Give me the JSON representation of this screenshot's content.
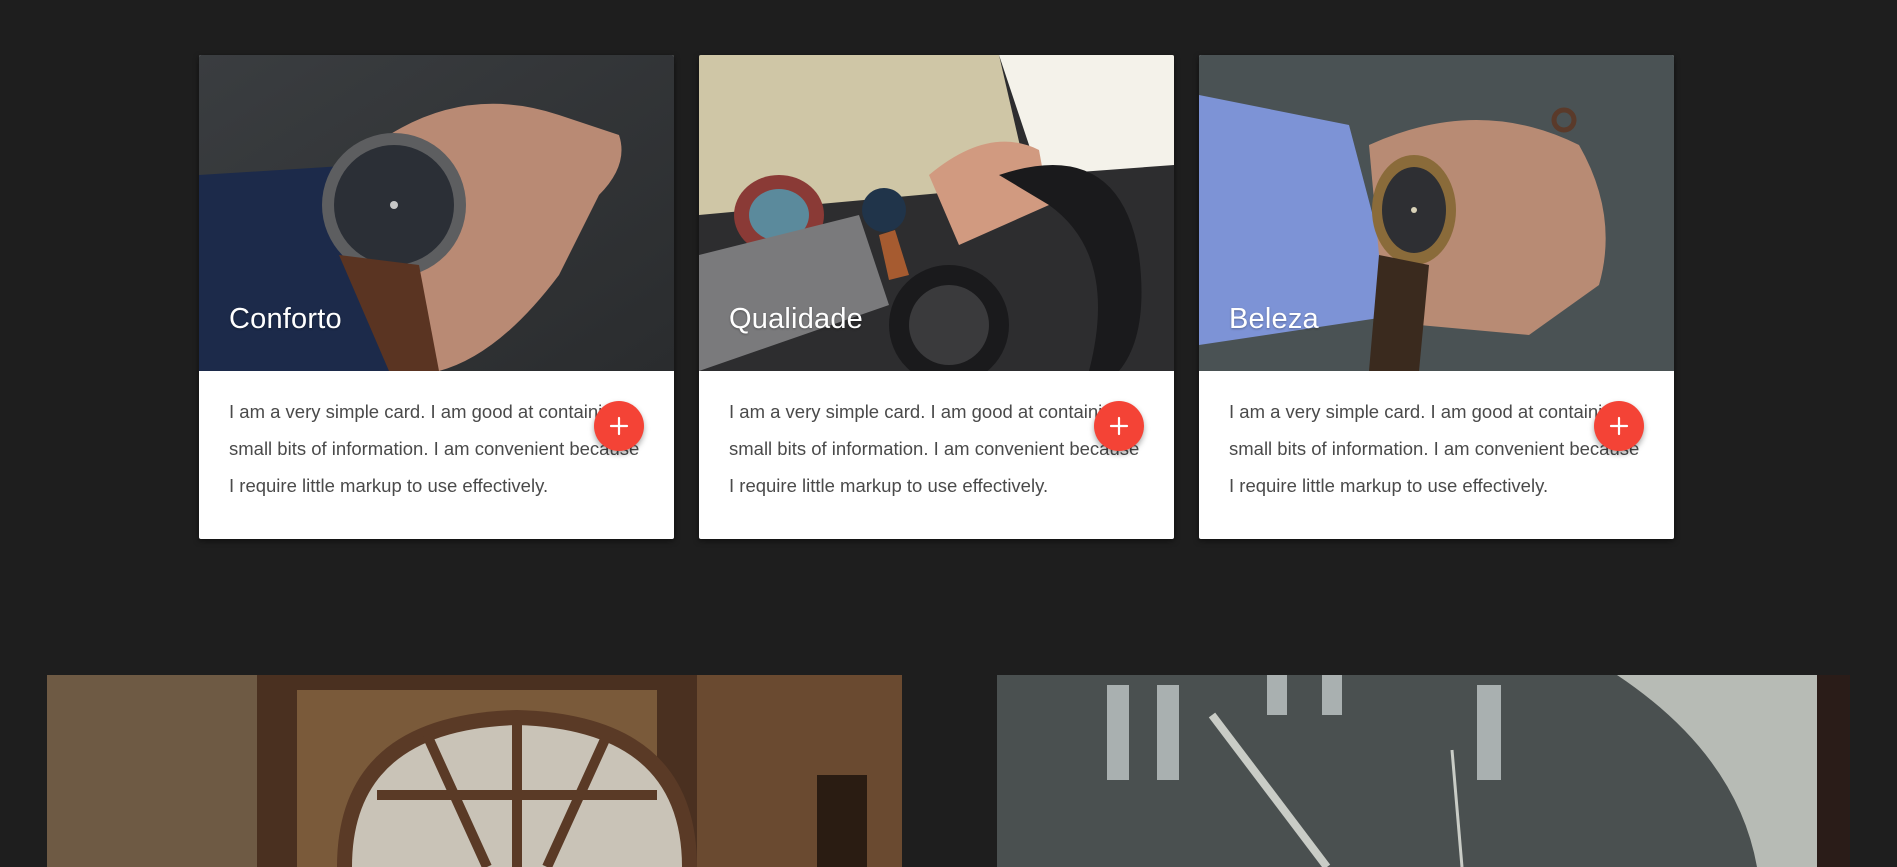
{
  "cards": [
    {
      "title": "Conforto",
      "text": "I am a very simple card. I am good at containing small bits of information. I am convenient because I require little markup to use effectively.",
      "image": "wrist-watch-photo",
      "action_icon": "plus-icon"
    },
    {
      "title": "Qualidade",
      "text": "I am a very simple card. I am good at containing small bits of information. I am convenient because I require little markup to use effectively.",
      "image": "driving-watch-photo",
      "action_icon": "plus-icon"
    },
    {
      "title": "Beleza",
      "text": "I am a very simple card. I am good at containing small bits of information. I am convenient because I require little markup to use effectively.",
      "image": "hand-watch-photo",
      "action_icon": "plus-icon"
    }
  ],
  "banners": [
    {
      "image": "window-clock-photo"
    },
    {
      "image": "clock-face-photo"
    }
  ],
  "colors": {
    "background": "#1e1e1e",
    "accent": "#f44336",
    "card": "#ffffff",
    "text": "#4a4a4a"
  }
}
